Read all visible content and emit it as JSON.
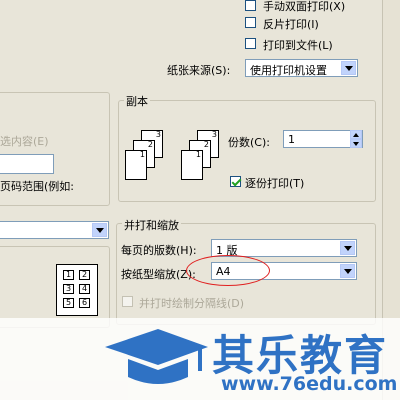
{
  "options": {
    "manual_duplex": "手动双面打印(X)",
    "reverse_print": "反片打印(I)",
    "print_to_file": "打印到文件(L)",
    "paper_source_label": "纸张来源(S):",
    "paper_source_value": "使用打印机设置"
  },
  "copies": {
    "title": "副本",
    "count_label": "份数(C):",
    "count_value": "1",
    "collate_label": "逐份打印(T)",
    "page_numbers": [
      "3",
      "2",
      "1",
      "3",
      "2",
      "1"
    ]
  },
  "range": {
    "selection_label": "选内容(E)",
    "page_range_label": "页码范围(例如:"
  },
  "zoom": {
    "title": "并打和缩放",
    "pages_per_sheet_label": "每页的版数(H):",
    "pages_per_sheet_value": "1 版",
    "scale_to_paper_label": "按纸型缩放(Z):",
    "scale_to_paper_value": "A4",
    "draw_dividers_label": "并打时绘制分隔线(D)",
    "preview_numbers": [
      "1",
      "2",
      "3",
      "4",
      "5",
      "6"
    ]
  },
  "watermark": {
    "brand_name": "其乐教育",
    "url": "www.76edu.com"
  },
  "colors": {
    "brand_blue": "#2f72c4",
    "highlight_red": "#e02020"
  }
}
